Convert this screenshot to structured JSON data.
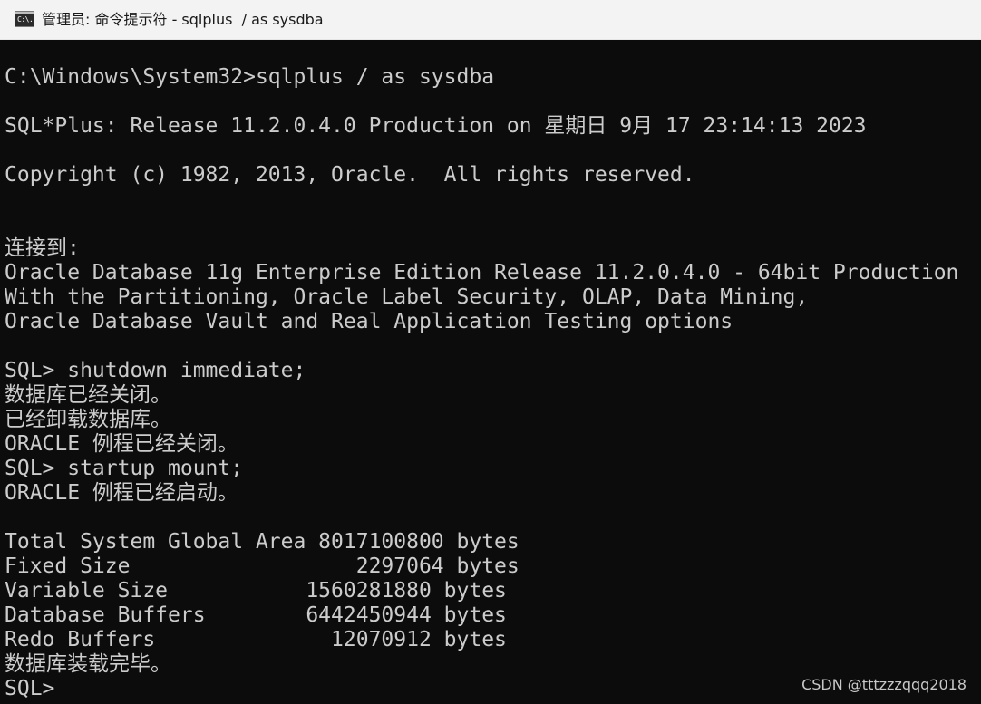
{
  "window": {
    "title": "管理员: 命令提示符 - sqlplus  / as sysdba",
    "icon": "cmd-icon",
    "icon_text": "C:\\."
  },
  "console": {
    "lines": [
      "C:\\Windows\\System32>sqlplus / as sysdba",
      "",
      "SQL*Plus: Release 11.2.0.4.0 Production on 星期日 9月 17 23:14:13 2023",
      "",
      "Copyright (c) 1982, 2013, Oracle.  All rights reserved.",
      "",
      "",
      "连接到:",
      "Oracle Database 11g Enterprise Edition Release 11.2.0.4.0 - 64bit Production",
      "With the Partitioning, Oracle Label Security, OLAP, Data Mining,",
      "Oracle Database Vault and Real Application Testing options",
      "",
      "SQL> shutdown immediate;",
      "数据库已经关闭。",
      "已经卸载数据库。",
      "ORACLE 例程已经关闭。",
      "SQL> startup mount;",
      "ORACLE 例程已经启动。",
      "",
      "Total System Global Area 8017100800 bytes",
      "Fixed Size                  2297064 bytes",
      "Variable Size           1560281880 bytes",
      "Database Buffers        6442450944 bytes",
      "Redo Buffers              12070912 bytes",
      "数据库装载完毕。",
      "SQL>"
    ]
  },
  "watermark": "CSDN @tttzzzqqq2018",
  "colors": {
    "background": "#0c0c0c",
    "foreground": "#cccccc",
    "titlebar": "#f3f3f3"
  }
}
